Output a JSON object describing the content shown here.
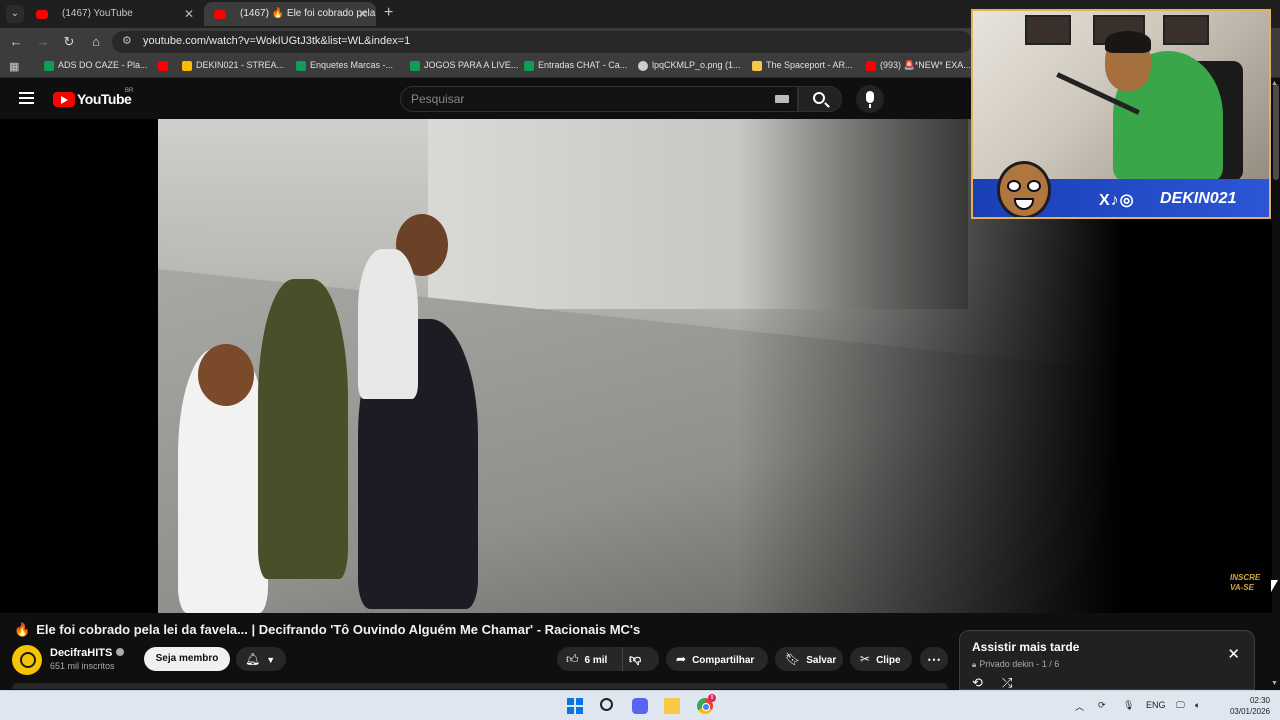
{
  "browser": {
    "tabs": [
      {
        "label": "(1467) YouTube",
        "active": false
      },
      {
        "label": "(1467) 🔥 Ele foi cobrado pela",
        "active": true
      }
    ],
    "new_tab_label": "+",
    "url": "youtube.com/watch?v=WokIUGtJ3tk&list=WL&index=1",
    "bookmarks": [
      {
        "label": "ADS DO CAZE - Pla...",
        "icon_color": "#0f9d58"
      },
      {
        "label": "",
        "icon_color": "#ff0000"
      },
      {
        "label": "DEKIN021 - STREA...",
        "icon_color": "#fbbc05"
      },
      {
        "label": "Enquetes Marcas -...",
        "icon_color": "#0f9d58"
      },
      {
        "label": "JOGOS PARA A LIVE...",
        "icon_color": "#0f9d58"
      },
      {
        "label": "Entradas CHAT - Ca...",
        "icon_color": "#0f9d58"
      },
      {
        "label": "lpqCKMLP_o.png (1...",
        "icon_color": "#cfcfcf"
      },
      {
        "label": "The Spaceport - AR...",
        "icon_color": "#f7c948"
      },
      {
        "label": "(993) 🚨*NEW* EXA...",
        "icon_color": "#ff0000"
      }
    ]
  },
  "youtube": {
    "logo_text": "YouTube",
    "country": "BR",
    "search_placeholder": "Pesquisar",
    "video": {
      "overlay_text": "INSCRE VA-SE",
      "webcam_handle": "DEKIN021",
      "webcam_socials": "X♪◎"
    },
    "title_emoji": "🔥",
    "title": "Ele foi cobrado pela lei da favela... | Decifrando 'Tô Ouvindo Alguém Me Chamar' - Racionais MC's",
    "channel": {
      "name": "DecifraHITS",
      "subscribers": "651 mil inscritos"
    },
    "join_label": "Seja membro",
    "actions": {
      "likes": "6 mil",
      "share": "Compartilhar",
      "save": "Salvar",
      "clip": "Clipe",
      "more": "⋯"
    },
    "playlist": {
      "title": "Assistir mais tarde",
      "meta": "Privado dekin - 1 / 6"
    }
  },
  "taskbar": {
    "language": "ENG",
    "time": "02:30",
    "date": "03/01/2026",
    "chrome_badge": "9"
  },
  "colors": {
    "brand": "#ff0000",
    "background": "#0f0f0f",
    "webcam_border": "#e2b15a",
    "banner": "#2c56d6"
  }
}
